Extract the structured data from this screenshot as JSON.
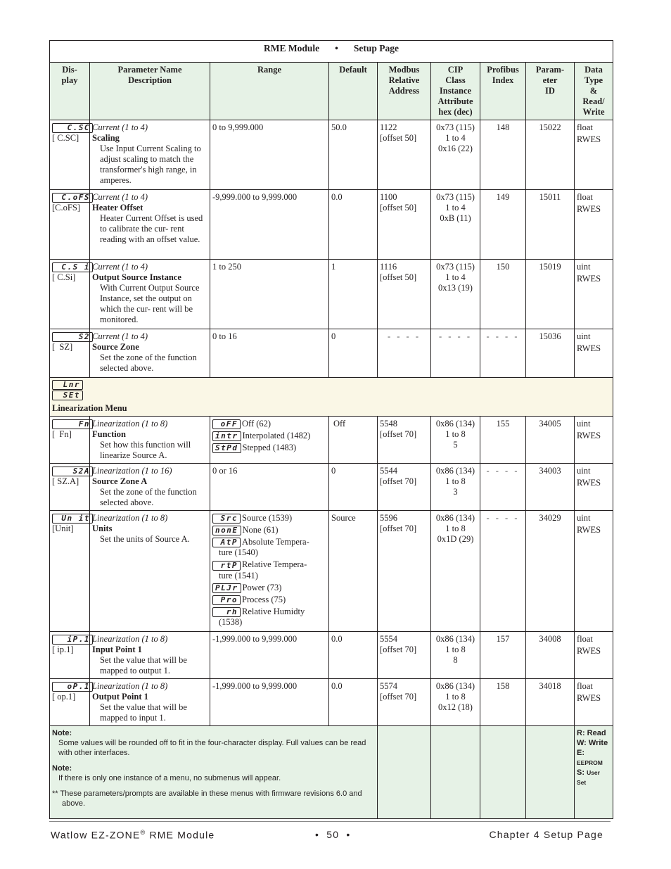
{
  "title": {
    "module": "RME Module",
    "separator": "•",
    "page": "Setup Page"
  },
  "headers": {
    "display": "Dis- play",
    "param": "Parameter Name Description",
    "range": "Range",
    "default": "Default",
    "modbus": "Modbus Relative Address",
    "cip": "CIP Class Instance Attribute hex (dec)",
    "profibus": "Profibus Index",
    "paramid": "Param- eter ID",
    "datatype": "Data Type & Read/ Write"
  },
  "rows": [
    {
      "lcd": "C.SC",
      "code": "[ C.SC]",
      "category": "Current (1 to 4)",
      "name": "Scaling",
      "description": "Use Input Current Scaling to adjust scaling to match the transformer's high range, in amperes.",
      "range": "0 to 9,999.000",
      "default": "50.0",
      "modbus": "1122",
      "modbus_offset": "[offset 50]",
      "cip_class": "0x73 (115)",
      "cip_instance": "1 to 4",
      "cip_attr": "0x16 (22)",
      "profibus": "148",
      "paramid": "15022",
      "dtype": "float",
      "rw": "RWES"
    },
    {
      "lcd": "C.oFS",
      "code": "[C.oFS]",
      "category": "Current (1 to 4)",
      "name": "Heater Offset",
      "description": "Heater Current Offset is used to calibrate the cur- rent reading with an offset value.",
      "range": "-9,999.000 to 9,999.000",
      "default": "0.0",
      "modbus": "1100",
      "modbus_offset": "[offset 50]",
      "cip_class": "0x73 (115)",
      "cip_instance": "1 to 4",
      "cip_attr": "0xB (11)",
      "profibus": "149",
      "paramid": "15011",
      "dtype": "float",
      "rw": "RWES"
    },
    {
      "lcd": "C.S i",
      "code": "[ C.Si]",
      "category": "Current (1 to 4)",
      "name": "Output Source Instance",
      "description": "With Current Output Source Instance, set the output on which the cur- rent will be monitored.",
      "range": "1 to 250",
      "default": "1",
      "modbus": "1116",
      "modbus_offset": "[offset 50]",
      "cip_class": "0x73 (115)",
      "cip_instance": "1 to 4",
      "cip_attr": "0x13 (19)",
      "profibus": "150",
      "paramid": "15019",
      "dtype": "uint",
      "rw": "RWES"
    },
    {
      "lcd": "S2",
      "code": "[  SZ]",
      "category": "Current (1 to 4)",
      "name": "Source Zone",
      "description": "Set the zone of the function selected above.",
      "range": "0 to 16",
      "default": "0",
      "modbus": "- - - -",
      "modbus_offset": "",
      "cip_class": "- - - -",
      "cip_instance": "",
      "cip_attr": "",
      "profibus": "- - - -",
      "paramid": "15036",
      "dtype": "uint",
      "rw": "RWES"
    }
  ],
  "menu": {
    "lcd1": "Lnr",
    "lcd2": "SEt",
    "title": "Linearization Menu"
  },
  "rows2": [
    {
      "lcd": "Fn",
      "code": "[  Fn]",
      "category": "Linearization (1 to 8)",
      "name": "Function",
      "description": "Set how this function will linearize Source A.",
      "options": [
        {
          "lcd": "oFF",
          "label": "Off (62)"
        },
        {
          "lcd": "intr",
          "label": "Interpolated (1482)"
        },
        {
          "lcd": "StPd",
          "label": "Stepped (1483)"
        }
      ],
      "default": "Off",
      "modbus": "5548",
      "modbus_offset": "[offset 70]",
      "cip_class": "0x86 (134)",
      "cip_instance": "1 to 8",
      "cip_attr": "5",
      "profibus": "155",
      "paramid": "34005",
      "dtype": "uint",
      "rw": "RWES"
    },
    {
      "lcd": "S2A",
      "code": "[ SZ.A]",
      "category": "Linearization (1 to 16)",
      "name": "Source Zone A",
      "description": "Set the zone of the function selected above.",
      "range": "0 or 16",
      "default": "0",
      "modbus": "5544",
      "modbus_offset": "[offset 70]",
      "cip_class": "0x86 (134)",
      "cip_instance": "1 to 8",
      "cip_attr": "3",
      "profibus": "- - - -",
      "paramid": "34003",
      "dtype": "uint",
      "rw": "RWES"
    },
    {
      "lcd": "Un it",
      "code": "[Unit]",
      "category": "Linearization (1 to 8)",
      "name": "Units",
      "description": "Set the units of Source A.",
      "options": [
        {
          "lcd": "Src",
          "label": "Source (1539)",
          "cont": ""
        },
        {
          "lcd": "nonE",
          "label": "None (61)",
          "cont": ""
        },
        {
          "lcd": "AtP",
          "label": "Absolute Tempera-",
          "cont": "ture (1540)"
        },
        {
          "lcd": "rtP",
          "label": "Relative Tempera-",
          "cont": "ture (1541)"
        },
        {
          "lcd": "PLJr",
          "label": "Power (73)",
          "cont": ""
        },
        {
          "lcd": "Pro",
          "label": "Process (75)",
          "cont": ""
        },
        {
          "lcd": "rh",
          "label": "Relative Humidty",
          "cont": "(1538)"
        }
      ],
      "default": "Source",
      "modbus": "5596",
      "modbus_offset": "[offset 70]",
      "cip_class": "0x86 (134)",
      "cip_instance": "1 to 8",
      "cip_attr": "0x1D (29)",
      "profibus": "- - - -",
      "paramid": "34029",
      "dtype": "uint",
      "rw": "RWES"
    },
    {
      "lcd": "iP.1",
      "code": "[ ip.1]",
      "category": "Linearization (1 to 8)",
      "name": "Input Point 1",
      "description": "Set the value that will be mapped to output 1.",
      "range": "-1,999.000 to 9,999.000",
      "default": "0.0",
      "modbus": "5554",
      "modbus_offset": "[offset 70]",
      "cip_class": "0x86 (134)",
      "cip_instance": "1 to 8",
      "cip_attr": "8",
      "profibus": "157",
      "paramid": "34008",
      "dtype": "float",
      "rw": "RWES"
    },
    {
      "lcd": "oP.1",
      "code": "[ op.1]",
      "category": "Linearization (1 to 8)",
      "name": "Output Point 1",
      "description": "Set the value that will be mapped to input 1.",
      "range": "-1,999.000 to 9,999.000",
      "default": "0.0",
      "modbus": "5574",
      "modbus_offset": "[offset 70]",
      "cip_class": "0x86 (134)",
      "cip_instance": "1 to 8",
      "cip_attr": "0x12 (18)",
      "profibus": "158",
      "paramid": "34018",
      "dtype": "float",
      "rw": "RWES"
    }
  ],
  "notes": {
    "note1_label": "Note:",
    "note1_text": "Some values will be rounded off to fit in the four-character display. Full values can be read with other interfaces.",
    "note2_label": "Note:",
    "note2_text": "If there is only one instance of a menu, no submenus will appear.",
    "footnote": "** These parameters/prompts are available in these menus with firmware revisions 6.0 and above."
  },
  "legend": {
    "r": "R: Read",
    "w": "W: Write",
    "e_key": "E:",
    "e_val": "EEPROM",
    "s_key": "S:",
    "s_val": "User Set"
  },
  "footer": {
    "left": "Watlow EZ-ZONE",
    "reg": "®",
    "left2": " RME Module",
    "center": "•  50  •",
    "right": "Chapter 4 Setup Page"
  },
  "colors": {
    "header_bg": "#e6f2e6",
    "menu_bg": "#faf7e6",
    "note_bg": "#e6f2e6",
    "border": "#231f20"
  }
}
